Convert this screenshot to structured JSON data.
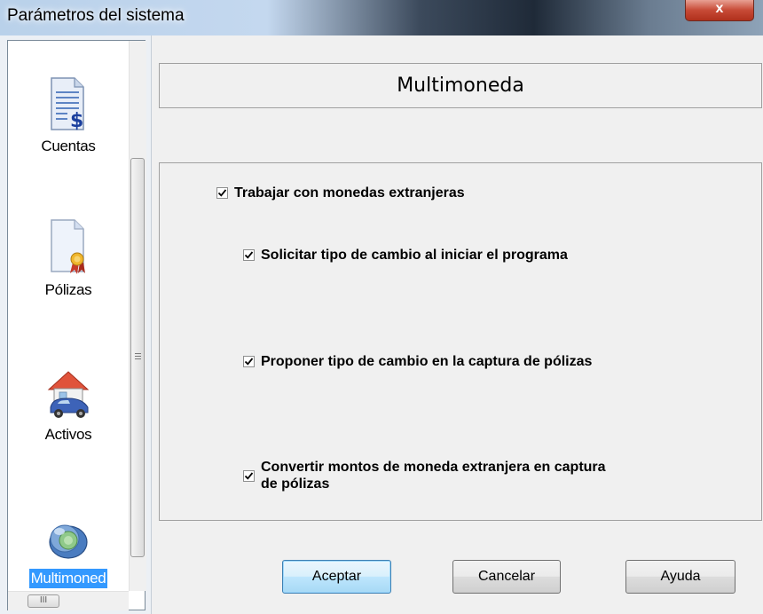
{
  "window": {
    "title": "Parámetros del sistema",
    "close_label": "x"
  },
  "sidebar": {
    "items": [
      {
        "label": "Cuentas",
        "icon": "ledger-dollar-icon"
      },
      {
        "label": "Pólizas",
        "icon": "certificate-document-icon"
      },
      {
        "label": "Activos",
        "icon": "house-car-icon"
      },
      {
        "label": "Multimoned",
        "icon": "coins-icon",
        "selected": true
      }
    ],
    "hscroll_grip": "III"
  },
  "main": {
    "section_title": "Multimoneda",
    "options": [
      {
        "label": "Trabajar con monedas extranjeras",
        "checked": true
      },
      {
        "label": "Solicitar tipo de cambio al iniciar el programa",
        "checked": true
      },
      {
        "label": "Proponer tipo de cambio en la captura de pólizas",
        "checked": true
      },
      {
        "label_line1": "Convertir montos de moneda extranjera en captura",
        "label_line2": "de pólizas",
        "checked": true
      }
    ]
  },
  "buttons": {
    "accept": "Aceptar",
    "cancel": "Cancelar",
    "help": "Ayuda"
  },
  "colors": {
    "selection": "#3399ff",
    "default_button_border": "#3c7fb1",
    "close_button": "#c74a36"
  }
}
